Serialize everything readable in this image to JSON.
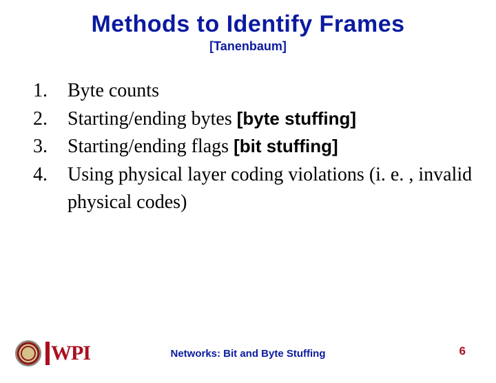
{
  "title": "Methods to Identify Frames",
  "subtitle": "[Tanenbaum]",
  "items": [
    {
      "num": "1.",
      "text": "Byte counts",
      "tag": ""
    },
    {
      "num": "2.",
      "text": "Starting/ending bytes ",
      "tag": "[byte stuffing]"
    },
    {
      "num": "3.",
      "text": "Starting/ending flags  ",
      "tag": "[bit stuffing]"
    },
    {
      "num": "4.",
      "text": "Using physical layer coding  violations (i. e. , invalid physical codes)",
      "tag": ""
    }
  ],
  "footer": "Networks: Bit and Byte Stuffing",
  "page": "6",
  "logo_text": "WPI"
}
